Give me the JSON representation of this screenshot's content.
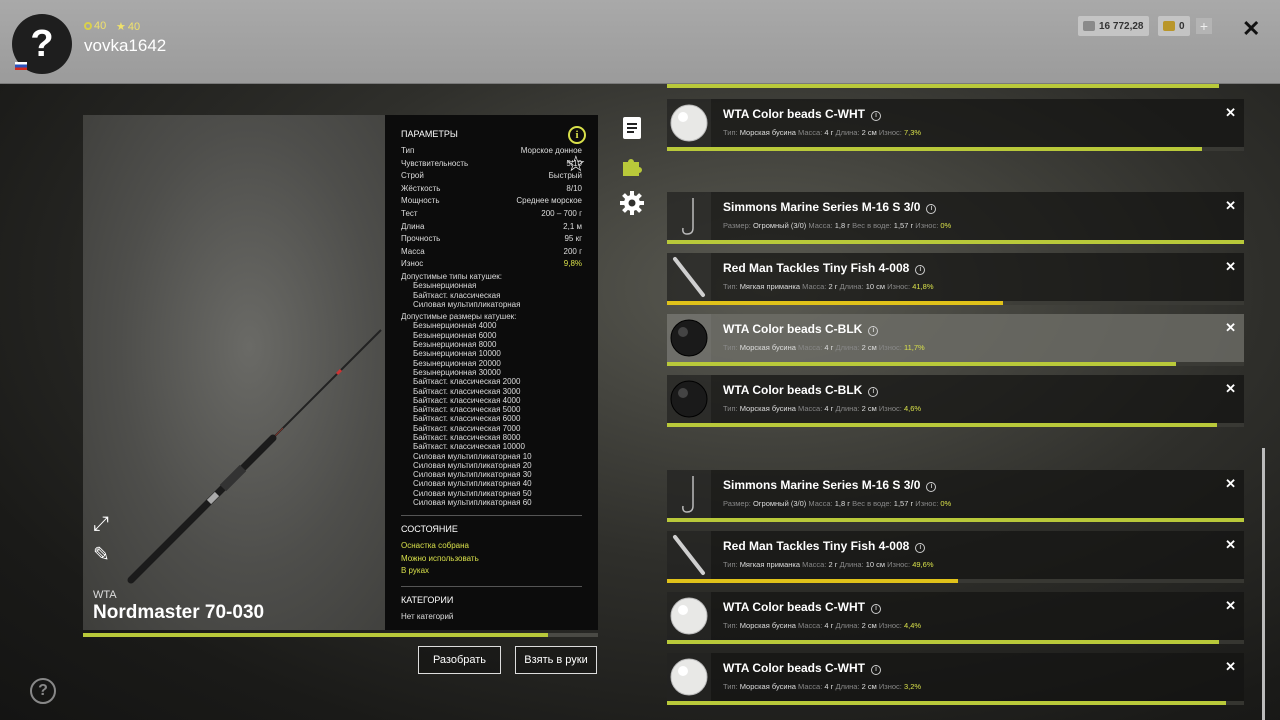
{
  "header": {
    "avatar_glyph": "?",
    "coins": "40",
    "stars": "40",
    "username": "vovka1642",
    "silver": "16 772,28",
    "gold": "0",
    "plus": "+",
    "close": "✕"
  },
  "rod": {
    "brand": "WTA",
    "name": "Nordmaster 70-030",
    "wear_fraction": 0.902
  },
  "params": {
    "title": "ПАРАМЕТРЫ",
    "rows": [
      {
        "k": "Тип",
        "v": "Морское донное"
      },
      {
        "k": "Чувствительность",
        "v": "5/10"
      },
      {
        "k": "Строй",
        "v": "Быстрый"
      },
      {
        "k": "Жёсткость",
        "v": "8/10"
      },
      {
        "k": "Мощность",
        "v": "Среднее морское"
      },
      {
        "k": "Тест",
        "v": "200 – 700 г"
      },
      {
        "k": "Длина",
        "v": "2,1 м"
      },
      {
        "k": "Прочность",
        "v": "95 кг"
      },
      {
        "k": "Масса",
        "v": "200 г"
      },
      {
        "k": "Износ",
        "v": "9,8%"
      }
    ],
    "reel_types_title": "Допустимые типы катушек:",
    "reel_types": [
      "Безынерционная",
      "Байткаст. классическая",
      "Силовая мультипликаторная"
    ],
    "reel_sizes_title": "Допустимые размеры катушек:",
    "reel_sizes": [
      "Безынерционная 4000",
      "Безынерционная 6000",
      "Безынерционная 8000",
      "Безынерционная 10000",
      "Безынерционная 20000",
      "Безынерционная 30000",
      "Байткаст. классическая 2000",
      "Байткаст. классическая 3000",
      "Байткаст. классическая 4000",
      "Байткаст. классическая 5000",
      "Байткаст. классическая 6000",
      "Байткаст. классическая 7000",
      "Байткаст. классическая 8000",
      "Байткаст. классическая 10000",
      "Силовая мультипликаторная 10",
      "Силовая мультипликаторная 20",
      "Силовая мультипликаторная 30",
      "Силовая мультипликаторная 40",
      "Силовая мультипликаторная 50",
      "Силовая мультипликаторная 60"
    ],
    "state_title": "СОСТОЯНИЕ",
    "state_items": [
      "Оснастка собрана",
      "Можно использовать",
      "В руках"
    ],
    "categories_title": "КАТЕГОРИИ",
    "categories_value": "Нет категорий"
  },
  "buttons": {
    "disassemble": "Разобрать",
    "take": "Взять в руки"
  },
  "colors": {
    "accent": "#d8e04a",
    "bar_high": "#b9c93a",
    "bar_low": "#e0c21a"
  },
  "items": [
    {
      "name": "WTA Color beads C-WHT",
      "thumb": "white-bead",
      "meta": [
        [
          "Тип:",
          "Морская бусина"
        ],
        [
          "Масса:",
          "4 г"
        ],
        [
          "Длина:",
          "2 см"
        ],
        [
          "Износ:",
          "7,3%"
        ]
      ],
      "wear": 0.927
    },
    {
      "name": "Simmons Marine Series M-16 S 3/0",
      "thumb": "hook",
      "meta": [
        [
          "Размер:",
          "Огромный (3/0)"
        ],
        [
          "Масса:",
          "1,8 г"
        ],
        [
          "Вес в воде:",
          "1,57 г"
        ],
        [
          "Износ:",
          "0%"
        ]
      ],
      "wear": 1.0
    },
    {
      "name": "Red Man Tackles Tiny Fish 4-008",
      "thumb": "soft-lure",
      "meta": [
        [
          "Тип:",
          "Мягкая приманка"
        ],
        [
          "Масса:",
          "2 г"
        ],
        [
          "Длина:",
          "10 см"
        ],
        [
          "Износ:",
          "41,8%"
        ]
      ],
      "wear": 0.582
    },
    {
      "name": "WTA Color beads C-BLK",
      "thumb": "black-bead",
      "meta": [
        [
          "Тип:",
          "Морская бусина"
        ],
        [
          "Масса:",
          "4 г"
        ],
        [
          "Длина:",
          "2 см"
        ],
        [
          "Износ:",
          "11,7%"
        ]
      ],
      "wear": 0.883
    },
    {
      "name": "WTA Color beads C-BLK",
      "thumb": "black-bead",
      "meta": [
        [
          "Тип:",
          "Морская бусина"
        ],
        [
          "Масса:",
          "4 г"
        ],
        [
          "Длина:",
          "2 см"
        ],
        [
          "Износ:",
          "4,6%"
        ]
      ],
      "wear": 0.954
    },
    {
      "name": "Simmons Marine Series M-16 S 3/0",
      "thumb": "hook",
      "meta": [
        [
          "Размер:",
          "Огромный (3/0)"
        ],
        [
          "Масса:",
          "1,8 г"
        ],
        [
          "Вес в воде:",
          "1,57 г"
        ],
        [
          "Износ:",
          "0%"
        ]
      ],
      "wear": 1.0
    },
    {
      "name": "Red Man Tackles Tiny Fish 4-008",
      "thumb": "soft-lure",
      "meta": [
        [
          "Тип:",
          "Мягкая приманка"
        ],
        [
          "Масса:",
          "2 г"
        ],
        [
          "Длина:",
          "10 см"
        ],
        [
          "Износ:",
          "49,6%"
        ]
      ],
      "wear": 0.504
    },
    {
      "name": "WTA Color beads C-WHT",
      "thumb": "white-bead",
      "meta": [
        [
          "Тип:",
          "Морская бусина"
        ],
        [
          "Масса:",
          "4 г"
        ],
        [
          "Длина:",
          "2 см"
        ],
        [
          "Износ:",
          "4,4%"
        ]
      ],
      "wear": 0.956
    },
    {
      "name": "WTA Color beads C-WHT",
      "thumb": "white-bead",
      "meta": [
        [
          "Тип:",
          "Морская бусина"
        ],
        [
          "Масса:",
          "4 г"
        ],
        [
          "Длина:",
          "2 см"
        ],
        [
          "Износ:",
          "3,2%"
        ]
      ],
      "wear": 0.968
    }
  ],
  "selected_item_index": 3
}
